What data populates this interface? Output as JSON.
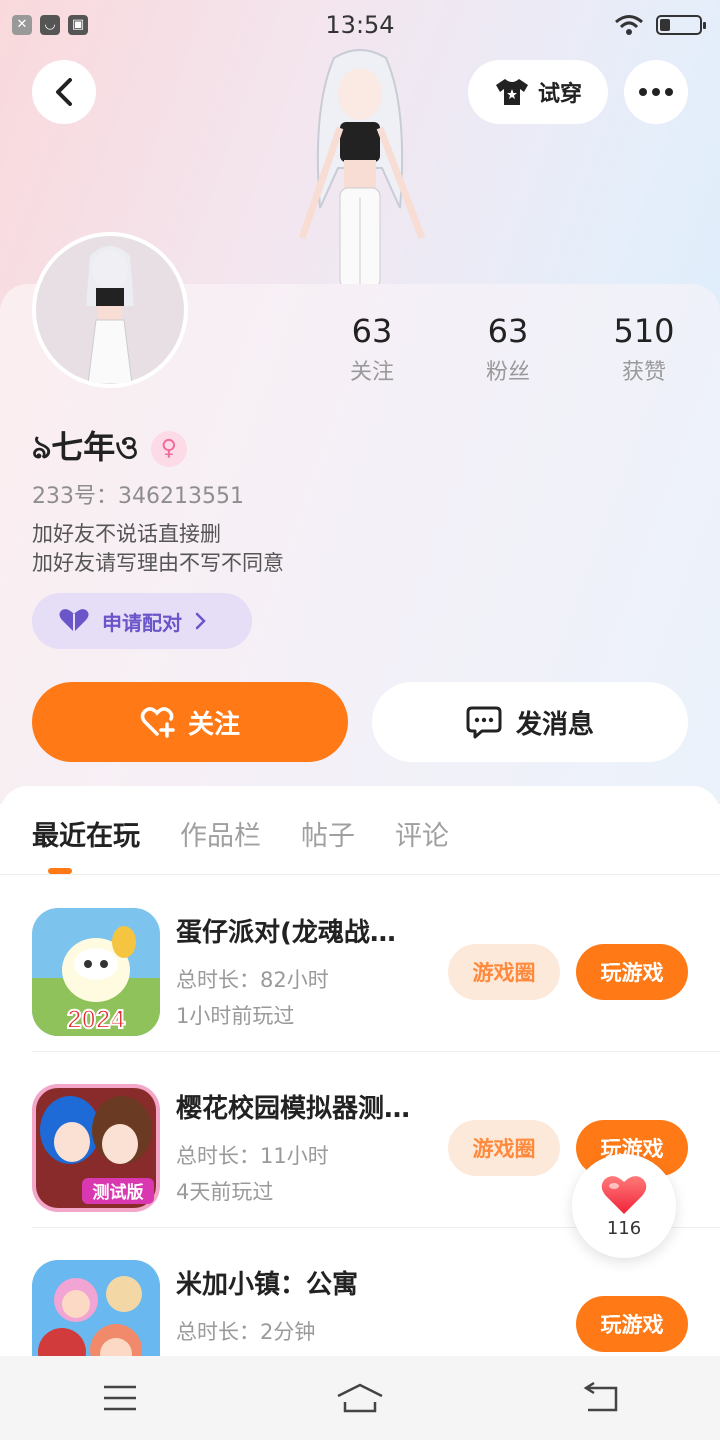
{
  "status_bar": {
    "time": "13:54",
    "left_icons": [
      "x-icon",
      "message-icon",
      "gallery-icon"
    ],
    "wifi": "wifi-icon",
    "battery_level": 0.2
  },
  "header": {
    "try_on_label": "试穿"
  },
  "profile": {
    "nickname": "ঌ七年ও",
    "gender_symbol": "♀",
    "uid": "233号：346213551",
    "bio_line1": "加好友不说话直接删",
    "bio_line2": "加好友请写理由不写不同意",
    "pair_label": "申请配对",
    "stats": [
      {
        "num": "63",
        "label": "关注"
      },
      {
        "num": "63",
        "label": "粉丝"
      },
      {
        "num": "510",
        "label": "获赞"
      }
    ],
    "follow_label": "关注",
    "message_label": "发消息"
  },
  "tabs": [
    {
      "label": "最近在玩",
      "active": true
    },
    {
      "label": "作品栏",
      "active": false
    },
    {
      "label": "帖子",
      "active": false
    },
    {
      "label": "评论",
      "active": false
    }
  ],
  "games": [
    {
      "title": "蛋仔派对(龙魂战…",
      "duration": "总时长：82小时",
      "last_played": "1小时前玩过",
      "circle_label": "游戏圈",
      "play_label": "玩游戏",
      "icon_text": "2024"
    },
    {
      "title": "樱花校园模拟器测…",
      "duration": "总时长：11小时",
      "last_played": "4天前玩过",
      "circle_label": "游戏圈",
      "play_label": "玩游戏",
      "icon_text": "测试版"
    },
    {
      "title": "米加小镇：公寓",
      "duration": "总时长：2分钟",
      "last_played": "",
      "circle_label": "",
      "play_label": "玩游戏",
      "icon_text": ""
    }
  ],
  "like_float": {
    "count": "116"
  },
  "colors": {
    "accent": "#ff7a17",
    "pair_purple": "#6a55c9"
  }
}
